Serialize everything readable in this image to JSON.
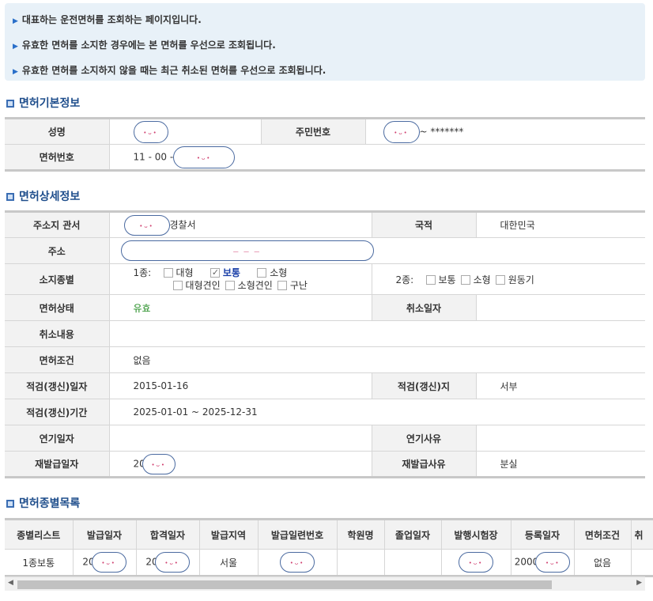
{
  "notices": [
    "대표하는 운전면허를 조회하는 페이지입니다.",
    "유효한 면허를 소지한 경우에는 본 면허를 우선으로 조회됩니다.",
    "유효한 면허를 소지하지 않을 때는 최근 취소된 면허를 우선으로 조회됩니다."
  ],
  "sections": {
    "basic": "면허기본정보",
    "detail": "면허상세정보",
    "list": "면허종별목록"
  },
  "basic": {
    "name_label": "성명",
    "rrn_label": "주민번호",
    "rrn_value": "~ *******",
    "license_no_label": "면허번호",
    "license_no_prefix": "11 - 00 -"
  },
  "detail": {
    "office_label": "주소지 관서",
    "office_suffix": "경찰서",
    "nationality_label": "국적",
    "nationality_value": "대한민국",
    "address_label": "주소",
    "type_label": "소지종별",
    "class1_label": "1종:",
    "class1_options": [
      "대형",
      "보통",
      "소형",
      "대형견인",
      "소형견인",
      "구난"
    ],
    "class2_label": "2종:",
    "class2_options": [
      "보통",
      "소형",
      "원동기"
    ],
    "status_label": "면허상태",
    "status_value": "유효",
    "cancel_date_label": "취소일자",
    "cancel_content_label": "취소내용",
    "condition_label": "면허조건",
    "condition_value": "없음",
    "renew_date_label": "적검(갱신)일자",
    "renew_date_value": "2015-01-16",
    "renew_place_label": "적검(갱신)지",
    "renew_place_value": "서부",
    "renew_period_label": "적검(갱신)기간",
    "renew_period_value": "2025-01-01 ~ 2025-12-31",
    "delay_date_label": "연기일자",
    "delay_reason_label": "연기사유",
    "reissue_date_label": "재발급일자",
    "reissue_date_prefix": "20",
    "reissue_reason_label": "재발급사유",
    "reissue_reason_value": "분실"
  },
  "list": {
    "headers": [
      "종별리스트",
      "발급일자",
      "합격일자",
      "발급지역",
      "발급일련번호",
      "학원명",
      "졸업일자",
      "발행시험장",
      "등록일자",
      "면허조건",
      "취"
    ],
    "row": {
      "type": "1종보통",
      "issue_prefix": "20",
      "pass_prefix": "20",
      "region": "서울",
      "reg_prefix": "2000",
      "condition": "없음"
    }
  },
  "colors": {
    "accent": "#1f4e8c",
    "notice_bg": "#e8f1f8",
    "valid": "#1e8a1e"
  }
}
